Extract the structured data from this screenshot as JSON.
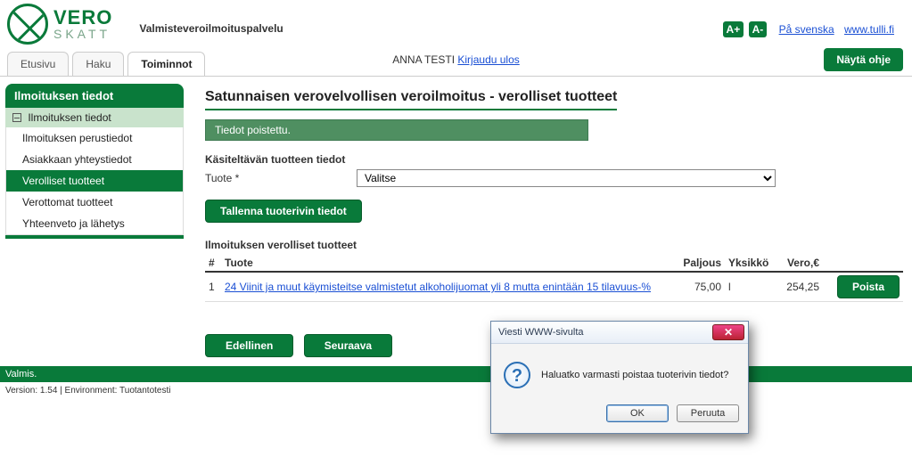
{
  "brand": {
    "line1": "VERO",
    "line2": "SKATT"
  },
  "service_title": "Valmisteveroilmoituspalvelu",
  "font_plus": "A+",
  "font_minus": "A-",
  "links": {
    "svenska": "På svenska",
    "tulli": "www.tulli.fi"
  },
  "tabs": {
    "home": "Etusivu",
    "search": "Haku",
    "actions": "Toiminnot"
  },
  "user": {
    "name": "ANNA TESTI",
    "logout": "Kirjaudu ulos"
  },
  "help_button": "Näytä ohje",
  "sidebar": {
    "heading": "Ilmoituksen tiedot",
    "group": "Ilmoituksen tiedot",
    "items": [
      "Ilmoituksen perustiedot",
      "Asiakkaan yhteystiedot",
      "Verolliset tuotteet",
      "Verottomat tuotteet",
      "Yhteenveto ja lähetys"
    ],
    "selected_index": 2
  },
  "page": {
    "title": "Satunnaisen verovelvollisen veroilmoitus - verolliset tuotteet",
    "info": "Tiedot poistettu.",
    "section1": "Käsiteltävän tuotteen tiedot",
    "product_label": "Tuote *",
    "product_selected": "Valitse",
    "save_btn": "Tallenna tuoterivin tiedot",
    "section2": "Ilmoituksen verolliset tuotteet",
    "table": {
      "headers": {
        "num": "#",
        "tuote": "Tuote",
        "paljous": "Paljous",
        "yksikko": "Yksikkö",
        "vero": "Vero,€"
      },
      "rows": [
        {
          "num": "1",
          "tuote": "24 Viinit ja muut käymisteitse valmistetut alkoholijuomat yli 8 mutta enintään 15 tilavuus-%",
          "paljous": "75,00",
          "yksikko": "l",
          "vero": "254,25"
        }
      ],
      "delete_btn": "Poista"
    },
    "prev_btn": "Edellinen",
    "next_btn": "Seuraava"
  },
  "status": "Valmis.",
  "version": "Version: 1.54 | Environment: Tuotantotesti",
  "dialog": {
    "title": "Viesti WWW-sivulta",
    "message": "Haluatko varmasti poistaa tuoterivin tiedot?",
    "ok": "OK",
    "cancel": "Peruuta"
  }
}
